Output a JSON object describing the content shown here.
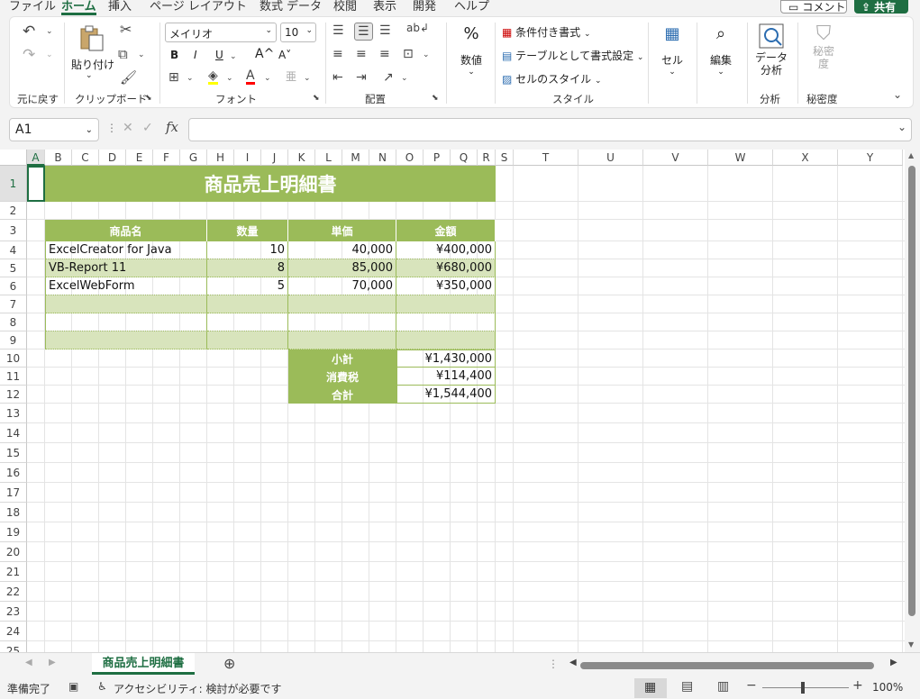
{
  "tabs": [
    "ファイル",
    "ホーム",
    "挿入",
    "ページ レイアウト",
    "数式",
    "データ",
    "校閲",
    "表示",
    "開発",
    "ヘルプ"
  ],
  "top_buttons": {
    "comment": "コメント",
    "share": "共有"
  },
  "ribbon": {
    "undo_group": "元に戻す",
    "clipboard": {
      "paste": "貼り付け",
      "label": "クリップボード"
    },
    "font": {
      "name": "メイリオ",
      "size": "10",
      "label": "フォント",
      "bold": "B",
      "italic": "I",
      "underline": "U",
      "grow": "A^",
      "shrink": "A˅"
    },
    "alignment": {
      "label": "配置"
    },
    "number": {
      "label": "数値"
    },
    "styles": {
      "conditional": "条件付き書式",
      "as_table": "テーブルとして書式設定",
      "cell_styles": "セルのスタイル",
      "label": "スタイル"
    },
    "cells": {
      "label": "セル"
    },
    "editing": {
      "label": "編集"
    },
    "analysis": {
      "data_analysis": "データ分析",
      "label": "分析"
    },
    "sensitivity": {
      "btn": "秘密度",
      "label": "秘密度"
    }
  },
  "formula_bar": {
    "name_box": "A1",
    "fx": "fx",
    "value": ""
  },
  "columns": [
    "A",
    "B",
    "C",
    "D",
    "E",
    "F",
    "G",
    "H",
    "I",
    "J",
    "K",
    "L",
    "M",
    "N",
    "O",
    "P",
    "Q",
    "R",
    "S",
    "T",
    "U",
    "V",
    "W",
    "X",
    "Y"
  ],
  "rows": [
    "1",
    "2",
    "3",
    "4",
    "5",
    "6",
    "7",
    "8",
    "9",
    "10",
    "11",
    "12",
    "13",
    "14",
    "15",
    "16",
    "17",
    "18",
    "19",
    "20",
    "21",
    "22",
    "23",
    "24",
    "25"
  ],
  "sheet": {
    "title": "商品売上明細書",
    "headers": [
      "商品名",
      "数量",
      "単価",
      "金額"
    ],
    "items": [
      [
        "ExcelCreator for Java",
        "10",
        "40,000",
        "¥400,000"
      ],
      [
        "VB-Report 11",
        "8",
        "85,000",
        "¥680,000"
      ],
      [
        "ExcelWebForm",
        "5",
        "70,000",
        "¥350,000"
      ],
      [
        "",
        "",
        "",
        ""
      ],
      [
        "",
        "",
        "",
        ""
      ],
      [
        "",
        "",
        "",
        ""
      ]
    ],
    "totals": [
      [
        "小計",
        "¥1,430,000"
      ],
      [
        "消費税",
        "¥114,400"
      ],
      [
        "合計",
        "¥1,544,400"
      ]
    ]
  },
  "sheet_tab": "商品売上明細書",
  "status": {
    "ready": "準備完了",
    "accessibility": "アクセシビリティ: 検討が必要です",
    "zoom": "100%"
  },
  "colors": {
    "accent": "#1e6e42",
    "table_header": "#9bbb59",
    "band": "#d8e4bc"
  }
}
